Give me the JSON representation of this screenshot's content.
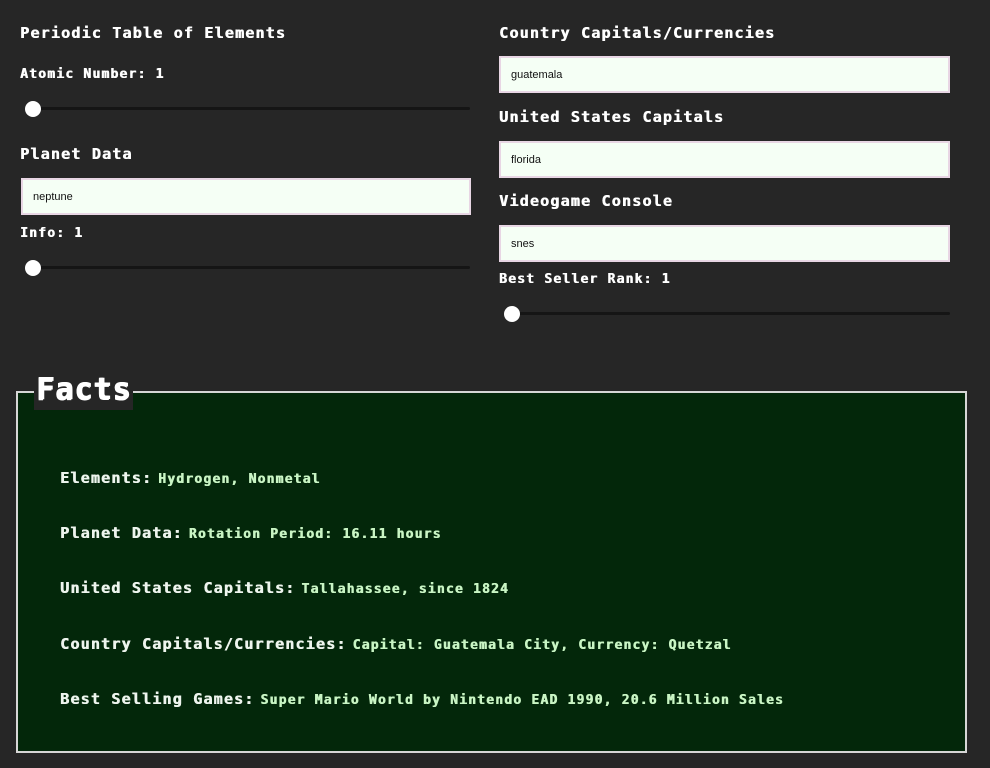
{
  "left": {
    "periodic": {
      "title": "Periodic Table of Elements",
      "atomic_label": "Atomic Number: 1",
      "atomic_value": 1
    },
    "planet": {
      "title": "Planet Data",
      "input_value": "neptune",
      "info_label": "Info: 1",
      "info_value": 1
    }
  },
  "right": {
    "country": {
      "title": "Country Capitals/Currencies",
      "input_value": "guatemala"
    },
    "us": {
      "title": "United States Capitals",
      "input_value": "florida"
    },
    "console": {
      "title": "Videogame Console",
      "input_value": "snes",
      "rank_label": "Best Seller Rank: 1",
      "rank_value": 1
    }
  },
  "facts": {
    "legend": "Facts",
    "items": [
      {
        "label": "Elements:",
        "value": "Hydrogen, Nonmetal"
      },
      {
        "label": "Planet Data:",
        "value": "Rotation Period: 16.11 hours"
      },
      {
        "label": "United States Capitals:",
        "value": "Tallahassee, since 1824"
      },
      {
        "label": "Country Capitals/Currencies:",
        "value": "Capital: Guatemala City, Currency: Quetzal"
      },
      {
        "label": "Best Selling Games:",
        "value": "Super Mario World by Nintendo EAD 1990, 20.6 Million Sales"
      }
    ]
  },
  "colors": {
    "background": "#262626",
    "facts_background": "#03270a",
    "input_background": "#f5fff5",
    "fact_value": "#c9f5c4"
  }
}
